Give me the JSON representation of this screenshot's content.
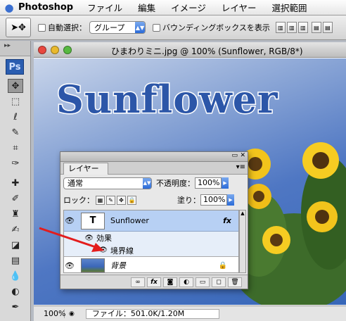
{
  "menubar": {
    "app_name": "Photoshop",
    "items": [
      "ファイル",
      "編集",
      "イメージ",
      "レイヤー",
      "選択範囲"
    ]
  },
  "options": {
    "auto_select_label": "自動選択：",
    "auto_select_value": "グループ",
    "bounding_box_label": "バウンディングボックスを表示"
  },
  "tools": {
    "logo": "Ps"
  },
  "document": {
    "title": "ひまわりミニ.jpg @ 100% (Sunflower, RGB/8*)",
    "canvas_text": "Sunflower",
    "zoom": "100%",
    "file_info": "ファイル：501.0K/1.20M"
  },
  "layers_panel": {
    "tab_label": "レイヤー",
    "blend_mode": "通常",
    "opacity_label": "不透明度：",
    "opacity_value": "100%",
    "lock_label": "ロック：",
    "fill_label": "塗り：",
    "fill_value": "100%",
    "layers": [
      {
        "name": "Sunflower",
        "thumb": "T",
        "fx": "fx",
        "selected": true
      },
      {
        "name": "効果",
        "type": "effects-group"
      },
      {
        "name": "境界線",
        "type": "effect"
      },
      {
        "name": "背景",
        "locked": true
      }
    ],
    "footer_fx": "fx"
  },
  "colors": {
    "selected_layer": "#b7d0f4",
    "arrow": "#e31c1c",
    "sky": "#3666b8",
    "text_fill": "#2c56a8"
  }
}
